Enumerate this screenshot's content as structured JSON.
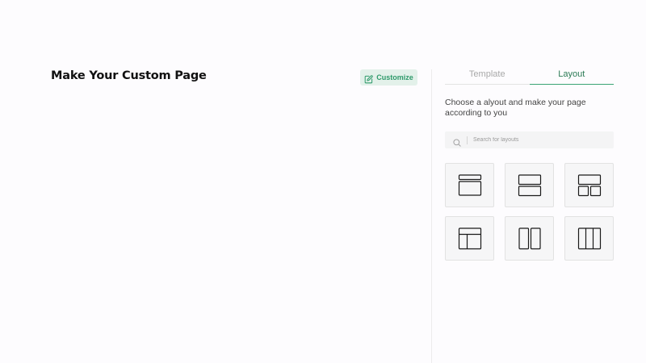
{
  "main": {
    "title": "Make Your Custom Page"
  },
  "toolbar": {
    "customize_label": "Customize",
    "customize_icon": "edit-icon",
    "accent_color": "#2f9a6b",
    "accent_bg": "#e3f1ea"
  },
  "panel": {
    "tabs": [
      {
        "label": "Template",
        "active": false
      },
      {
        "label": "Layout",
        "active": true
      }
    ],
    "description": "Choose a alyout and make your page according to you",
    "search": {
      "placeholder": "Search for layouts",
      "value": "",
      "icon": "search-icon"
    },
    "layouts": [
      {
        "icon": "layout-header-body-icon"
      },
      {
        "icon": "layout-two-rows-icon"
      },
      {
        "icon": "layout-top-two-bottom-icon"
      },
      {
        "icon": "layout-header-sidebar-icon"
      },
      {
        "icon": "layout-two-columns-icon"
      },
      {
        "icon": "layout-three-columns-icon"
      }
    ]
  }
}
